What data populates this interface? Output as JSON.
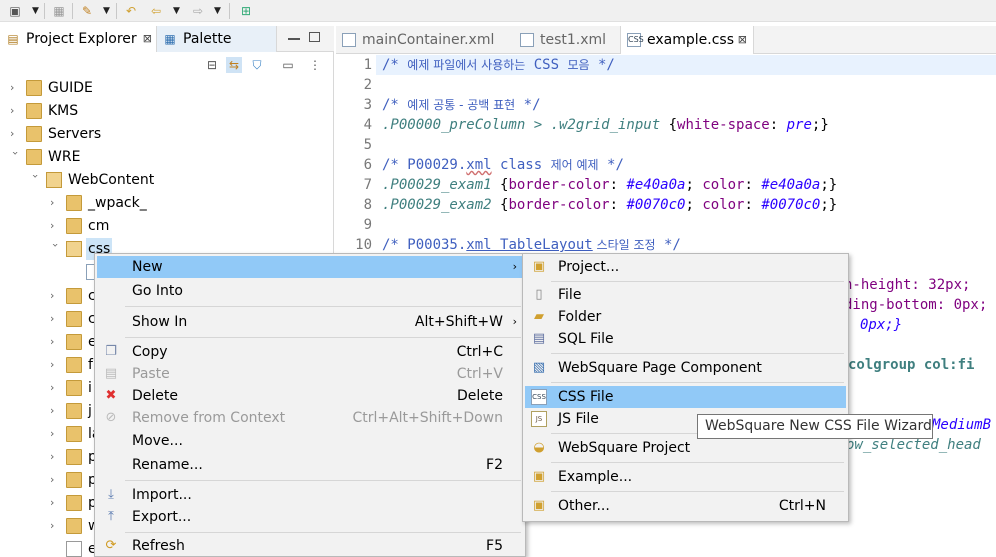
{
  "toolbar": {
    "icons": [
      "new-icon",
      "save-icon",
      "run-icon",
      "back-history-icon",
      "back-icon",
      "forward-icon",
      "open-perspective-icon"
    ]
  },
  "left_panel": {
    "tabs": [
      {
        "label": "Project Explorer",
        "close": "⊠"
      },
      {
        "label": "Palette"
      }
    ],
    "tree": [
      {
        "label": "GUIDE"
      },
      {
        "label": "KMS"
      },
      {
        "label": "Servers"
      },
      {
        "label": "WRE"
      },
      {
        "label": "WebContent"
      },
      {
        "label": "_wpack_"
      },
      {
        "label": "cm"
      },
      {
        "label": "css"
      },
      {
        "label": "c"
      },
      {
        "label": "c"
      },
      {
        "label": "e"
      },
      {
        "label": "f"
      },
      {
        "label": "i"
      },
      {
        "label": "j"
      },
      {
        "label": "la"
      },
      {
        "label": "p"
      },
      {
        "label": "p"
      },
      {
        "label": "p"
      },
      {
        "label": "w"
      },
      {
        "label": "e"
      }
    ]
  },
  "editor": {
    "tabs": [
      {
        "label": "mainContainer.xml"
      },
      {
        "label": "test1.xml"
      },
      {
        "label": "example.css",
        "close": "⊠"
      }
    ],
    "line_numbers": [
      "1",
      "2",
      "3",
      "4",
      "5",
      "6",
      "7",
      "8",
      "9",
      "10"
    ],
    "partial_lines": {
      "a": "n-height: 32px;",
      "b": "ding-bottom: 0px;",
      "c": "0px;}",
      "d": "colgroup col:fi",
      "e": "MediumB",
      "f": "ow_selected_head"
    }
  },
  "context_menu": {
    "items": [
      {
        "label": "New",
        "shortcut": "",
        "arrow": "›"
      },
      {
        "label": "Go Into",
        "shortcut": ""
      },
      {
        "label": "Show In",
        "shortcut": "Alt+Shift+W",
        "arrow": "›"
      },
      {
        "label": "Copy",
        "shortcut": "Ctrl+C"
      },
      {
        "label": "Paste",
        "shortcut": "Ctrl+V"
      },
      {
        "label": "Delete",
        "shortcut": "Delete"
      },
      {
        "label": "Remove from Context",
        "shortcut": "Ctrl+Alt+Shift+Down"
      },
      {
        "label": "Move...",
        "shortcut": ""
      },
      {
        "label": "Rename...",
        "shortcut": "F2"
      },
      {
        "label": "Import...",
        "shortcut": ""
      },
      {
        "label": "Export...",
        "shortcut": ""
      },
      {
        "label": "Refresh",
        "shortcut": "F5"
      }
    ]
  },
  "submenu": {
    "items": [
      {
        "label": "Project...",
        "shortcut": ""
      },
      {
        "label": "File",
        "shortcut": ""
      },
      {
        "label": "Folder",
        "shortcut": ""
      },
      {
        "label": "SQL File",
        "shortcut": ""
      },
      {
        "label": "WebSquare Page Component",
        "shortcut": ""
      },
      {
        "label": "CSS File",
        "shortcut": ""
      },
      {
        "label": "JS File",
        "shortcut": ""
      },
      {
        "label": "WebSquare Project",
        "shortcut": ""
      },
      {
        "label": "Example...",
        "shortcut": ""
      },
      {
        "label": "Other...",
        "shortcut": "Ctrl+N"
      }
    ]
  },
  "tooltip": {
    "text": "WebSquare New CSS File Wizard"
  },
  "code": {
    "l1_a": "/* ",
    "l1_k": "예제 파일에서 사용하는",
    "l1_b": " CSS ",
    "l1_k2": "모음",
    "l1_c": " */",
    "l3_a": "/* ",
    "l3_k": "예제 공통 - 공백 표현",
    "l3_c": " */",
    "l4_sel": ".P00000_preColumn > .w2grid_input ",
    "l4_ob": "{",
    "l4_prop": "white-space",
    "l4_colon": ": ",
    "l4_val": "pre",
    "l4_end": ";}",
    "l6_a": "/* P00029.",
    "l6_sq": "xml",
    "l6_b": " class ",
    "l6_k": "제어 예제",
    "l6_c": " */",
    "l7_sel": ".P00029_exam1 ",
    "l7_ob": "{",
    "l7_p1": "border-color",
    "l7_c1": ": ",
    "l7_v1": "#e40a0a",
    "l7_s1": "; ",
    "l7_p2": "color",
    "l7_c2": ": ",
    "l7_v2": "#e40a0a",
    "l7_end": ";}",
    "l8_sel": ".P00029_exam2 ",
    "l8_ob": "{",
    "l8_p1": "border-color",
    "l8_c1": ": ",
    "l8_v1": "#0070c0",
    "l8_s1": "; ",
    "l8_p2": "color",
    "l8_c2": ": ",
    "l8_v2": "#0070c0",
    "l8_end": ";}",
    "l10_a": "/* P00035.",
    "l10_sq": "xml TableLayout",
    "l10_k": " 스타일 조정",
    "l10_c": " */"
  }
}
